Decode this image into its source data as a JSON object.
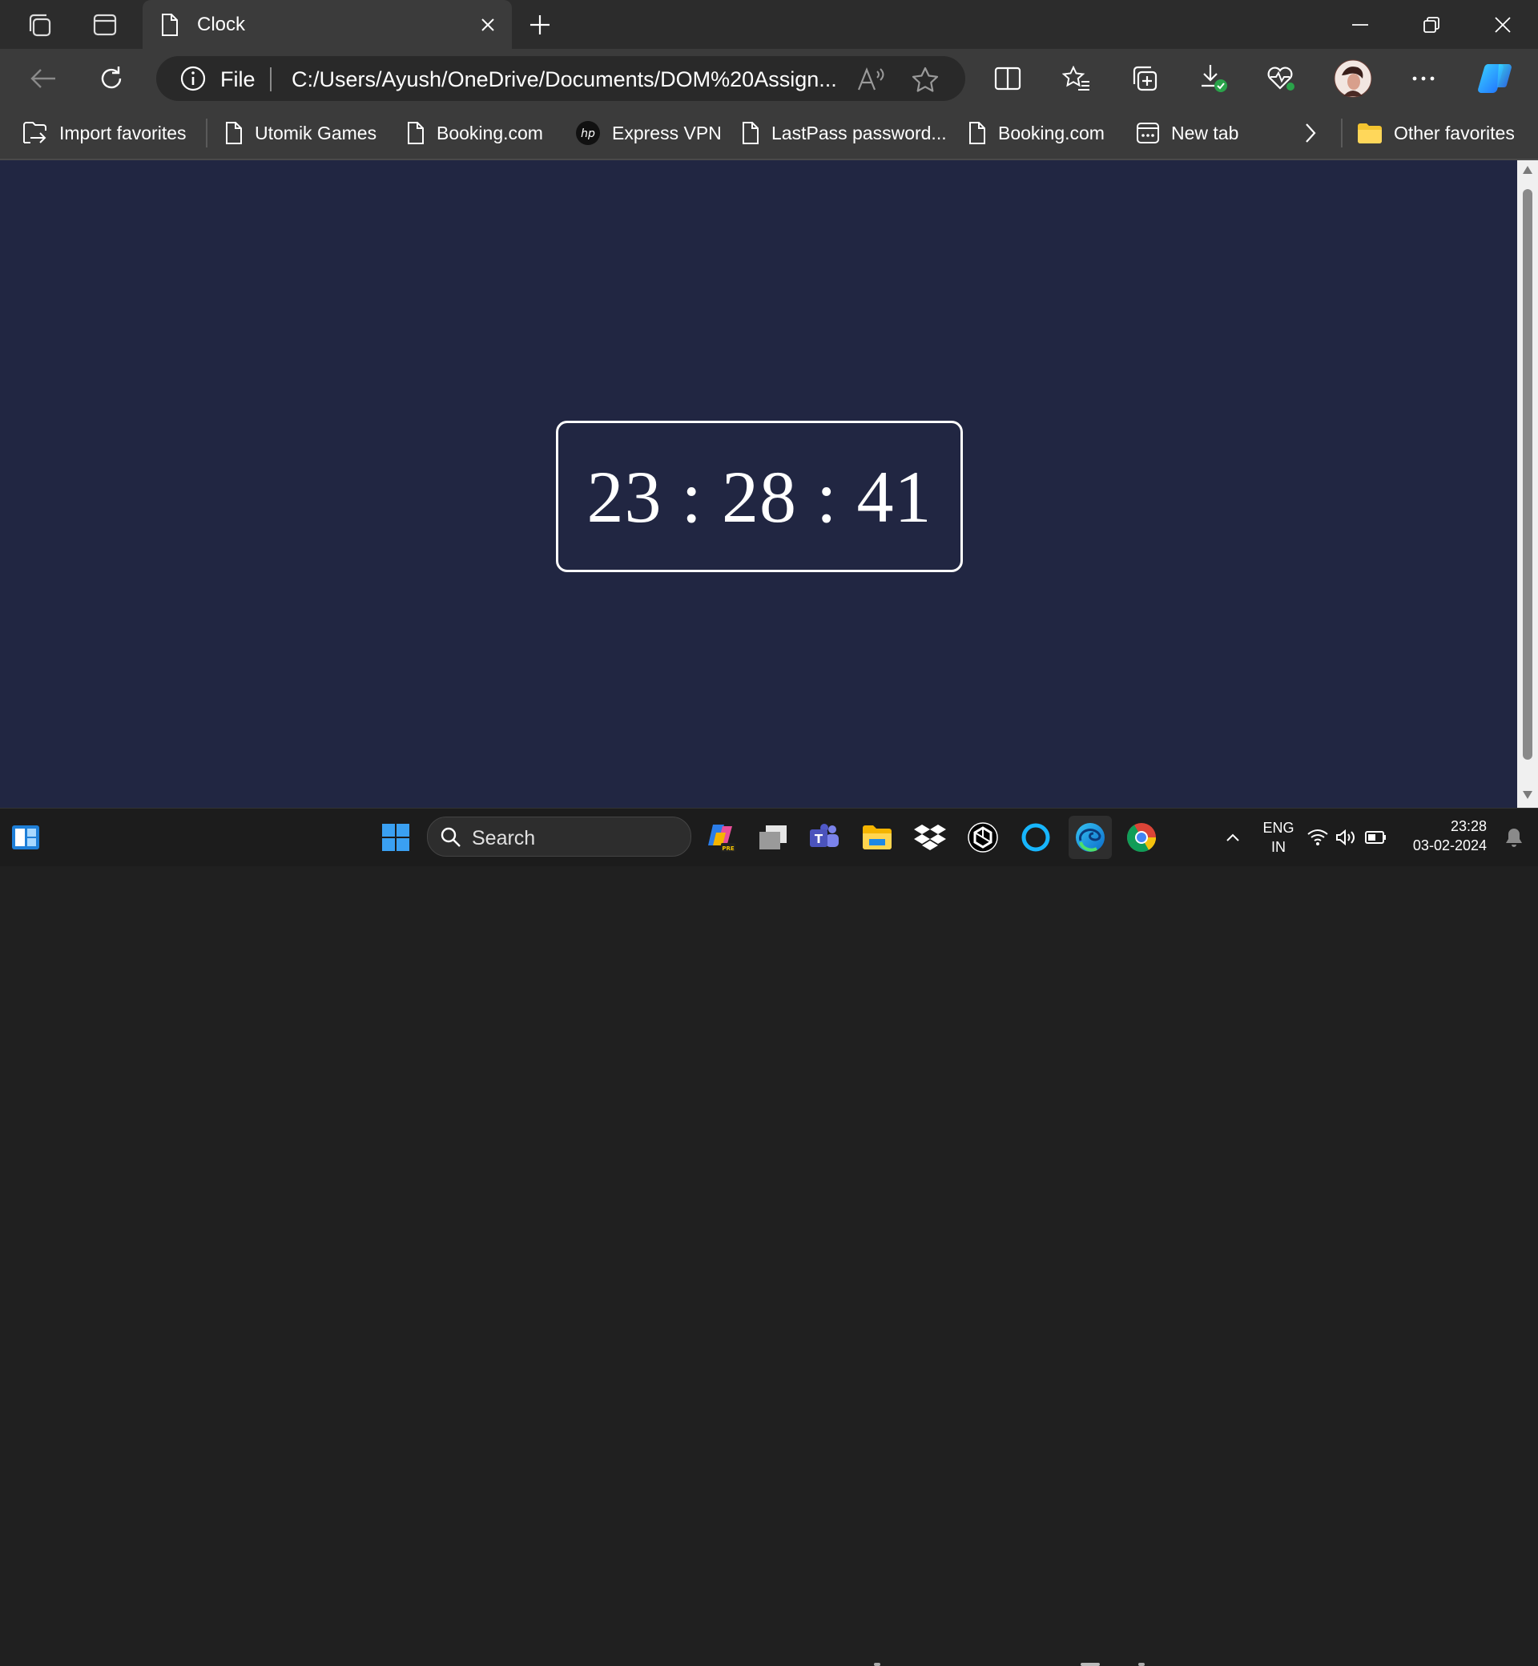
{
  "browser": {
    "tab_title": "Clock",
    "omnibox": {
      "scheme_label": "File",
      "url": "C:/Users/Ayush/OneDrive/Documents/DOM%20Assign..."
    },
    "favorites": [
      {
        "label": "Import favorites",
        "icon": "import-icon"
      },
      {
        "label": "Utomik Games",
        "icon": "page-icon"
      },
      {
        "label": "Booking.com",
        "icon": "page-icon"
      },
      {
        "label": "Express VPN",
        "icon": "hp-icon"
      },
      {
        "label": "LastPass password...",
        "icon": "page-icon"
      },
      {
        "label": "Booking.com",
        "icon": "page-icon"
      },
      {
        "label": "New tab",
        "icon": "newtab-icon"
      }
    ],
    "other_favorites": "Other favorites"
  },
  "page": {
    "clock": "23 : 28 : 41",
    "background": "#212642",
    "border_color": "#ffffff"
  },
  "taskbar": {
    "search_placeholder": "Search",
    "language": "ENG",
    "region": "IN",
    "time": "23:28",
    "date": "03-02-2024"
  }
}
